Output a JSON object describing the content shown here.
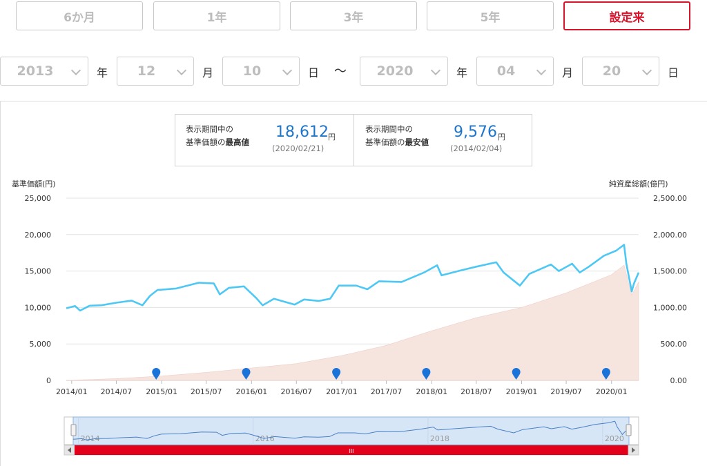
{
  "period_buttons": [
    {
      "label": "6か月",
      "active": false
    },
    {
      "label": "1年",
      "active": false
    },
    {
      "label": "3年",
      "active": false
    },
    {
      "label": "5年",
      "active": false
    },
    {
      "label": "設定来",
      "active": true
    }
  ],
  "date_range": {
    "start_year": "2013",
    "start_month": "12",
    "start_day": "10",
    "end_year": "2020",
    "end_month": "04",
    "end_day": "20",
    "year_unit": "年",
    "month_unit": "月",
    "day_unit": "日",
    "separator": "〜"
  },
  "summary": {
    "high": {
      "label_line1": "表示期間中の",
      "label_line2_prefix": "基準価額の",
      "label_line2_bold": "最高値",
      "value": "18,612",
      "unit": "円",
      "date": "(2020/02/21)"
    },
    "low": {
      "label_line1": "表示期間中の",
      "label_line2_prefix": "基準価額の",
      "label_line2_bold": "最安値",
      "value": "9,576",
      "unit": "円",
      "date": "(2014/02/04)"
    }
  },
  "colors": {
    "accent": "#d7142c",
    "nav_line": "#4dc8f4",
    "net_assets_area": "#f6e4df",
    "value_blue": "#1f75c9",
    "marker": "#1a73d9",
    "navigator_line": "#4a7fc4",
    "navigator_fill": "#d6e6f7"
  },
  "chart_data": {
    "type": "line",
    "xlabels": [
      "2014/01",
      "2014/07",
      "2015/01",
      "2015/07",
      "2016/01",
      "2016/07",
      "2017/01",
      "2017/07",
      "2018/01",
      "2018/07",
      "2019/01",
      "2019/07",
      "2020/01"
    ],
    "y_left": {
      "title": "基準価額(円)",
      "ticks": [
        "0",
        "5,000",
        "10,000",
        "15,000",
        "20,000",
        "25,000"
      ],
      "range": [
        0,
        25000
      ]
    },
    "y_right": {
      "title": "純資産総額(億円)",
      "ticks": [
        "0.00",
        "500.00",
        "1,000.00",
        "1,500.00",
        "2,000.00",
        "2,500.00"
      ],
      "range": [
        0,
        2500
      ]
    },
    "x_range": [
      "2013-12-10",
      "2020-04-20"
    ],
    "series": [
      {
        "type": "line",
        "points": [
          [
            "2013-12-10",
            9900
          ],
          [
            "2014-01-15",
            10200
          ],
          [
            "2014-02-04",
            9576
          ],
          [
            "2014-03-15",
            10250
          ],
          [
            "2014-05-01",
            10300
          ],
          [
            "2014-07-01",
            10650
          ],
          [
            "2014-09-01",
            10950
          ],
          [
            "2014-10-15",
            10300
          ],
          [
            "2014-11-15",
            11600
          ],
          [
            "2014-12-15",
            12400
          ],
          [
            "2015-03-01",
            12600
          ],
          [
            "2015-06-01",
            13400
          ],
          [
            "2015-08-01",
            13300
          ],
          [
            "2015-08-25",
            11800
          ],
          [
            "2015-10-01",
            12700
          ],
          [
            "2015-12-01",
            12900
          ],
          [
            "2016-01-20",
            11300
          ],
          [
            "2016-02-15",
            10300
          ],
          [
            "2016-04-01",
            11200
          ],
          [
            "2016-06-24",
            10400
          ],
          [
            "2016-08-01",
            11100
          ],
          [
            "2016-10-01",
            10900
          ],
          [
            "2016-11-15",
            11200
          ],
          [
            "2016-12-20",
            13000
          ],
          [
            "2017-03-01",
            13000
          ],
          [
            "2017-04-15",
            12500
          ],
          [
            "2017-06-01",
            13600
          ],
          [
            "2017-09-01",
            13500
          ],
          [
            "2017-12-01",
            14800
          ],
          [
            "2018-01-23",
            15800
          ],
          [
            "2018-02-10",
            14400
          ],
          [
            "2018-05-01",
            15100
          ],
          [
            "2018-07-01",
            15600
          ],
          [
            "2018-09-20",
            16200
          ],
          [
            "2018-10-20",
            14800
          ],
          [
            "2018-12-25",
            13000
          ],
          [
            "2019-02-01",
            14600
          ],
          [
            "2019-04-30",
            15900
          ],
          [
            "2019-06-01",
            15000
          ],
          [
            "2019-07-25",
            16000
          ],
          [
            "2019-08-25",
            14800
          ],
          [
            "2019-10-01",
            15600
          ],
          [
            "2019-12-01",
            17100
          ],
          [
            "2020-01-20",
            17800
          ],
          [
            "2020-02-21",
            18612
          ],
          [
            "2020-03-01",
            16000
          ],
          [
            "2020-03-23",
            12200
          ],
          [
            "2020-04-01",
            13300
          ],
          [
            "2020-04-20",
            14800
          ]
        ]
      },
      {
        "type": "area",
        "points": [
          [
            "2013-12-10",
            0
          ],
          [
            "2014-07-01",
            25
          ],
          [
            "2015-01-01",
            60
          ],
          [
            "2015-07-01",
            110
          ],
          [
            "2016-01-01",
            170
          ],
          [
            "2016-07-01",
            230
          ],
          [
            "2017-01-01",
            340
          ],
          [
            "2017-07-01",
            480
          ],
          [
            "2018-01-01",
            680
          ],
          [
            "2018-07-01",
            860
          ],
          [
            "2019-01-01",
            1000
          ],
          [
            "2019-07-01",
            1200
          ],
          [
            "2020-01-01",
            1450
          ],
          [
            "2020-02-21",
            1580
          ],
          [
            "2020-03-23",
            1170
          ],
          [
            "2020-04-20",
            1350
          ]
        ]
      }
    ],
    "markers": [
      "2014-12-10",
      "2015-12-10",
      "2016-12-10",
      "2017-12-10",
      "2018-12-10",
      "2019-12-10"
    ],
    "navigator": {
      "labels": [
        "2014",
        "2016",
        "2018",
        "2020"
      ],
      "handle_text": "III"
    }
  }
}
